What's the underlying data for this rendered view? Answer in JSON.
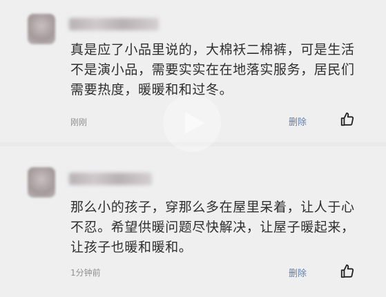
{
  "comments": [
    {
      "text": "真是应了小品里说的，大棉袄二棉裤，可是生活不是演小品，需要实实在在地落实服务，居民们需要热度，暖暖和和过冬。",
      "time": "刚刚",
      "delete_label": "删除",
      "like_icon": "thumbs-up-icon"
    },
    {
      "text": "那么小的孩子，穿那么多在屋里呆着，让人于心不忍。希望供暖问题尽快解决，让屋子暖起来，让孩子也暖和暖和。",
      "time": "1分钟前",
      "delete_label": "删除",
      "like_icon": "thumbs-up-icon"
    }
  ],
  "overlay": {
    "icon": "play-icon"
  },
  "colors": {
    "background": "#e9e9ea",
    "link": "#5f7fb0",
    "text": "#2e2e2e",
    "meta": "#8f8f8f"
  }
}
